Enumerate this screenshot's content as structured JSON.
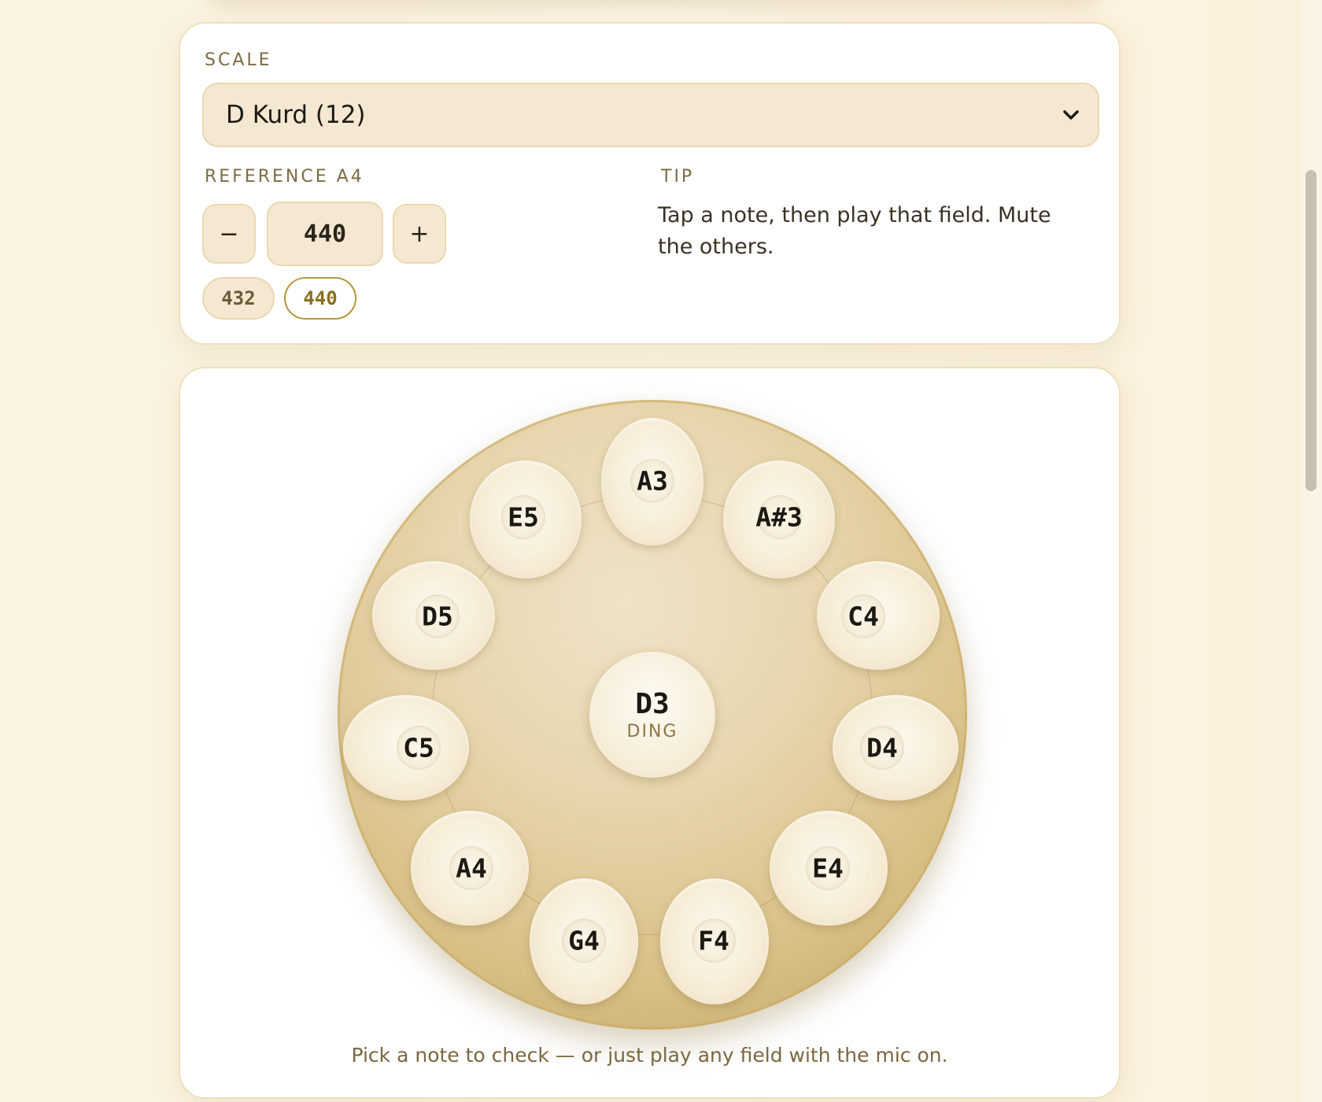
{
  "settings": {
    "scale_label": "SCALE",
    "scale_value": "D Kurd (12)",
    "reference_label": "REFERENCE A4",
    "minus_label": "−",
    "plus_label": "+",
    "reference_value": "440",
    "presets": [
      "432",
      "440"
    ],
    "active_preset": "440",
    "tip_label": "TIP",
    "tip_text": "Tap a note, then play that field. Mute the others."
  },
  "pan": {
    "ding": {
      "note": "D3",
      "sub": "DING"
    },
    "fields": [
      {
        "note": "A3"
      },
      {
        "note": "A#3"
      },
      {
        "note": "C4"
      },
      {
        "note": "D4"
      },
      {
        "note": "E4"
      },
      {
        "note": "F4"
      },
      {
        "note": "G4"
      },
      {
        "note": "A4"
      },
      {
        "note": "C5"
      },
      {
        "note": "D5"
      },
      {
        "note": "E5"
      }
    ],
    "hint": "Pick a note to check — or just play any field with the mic on."
  }
}
